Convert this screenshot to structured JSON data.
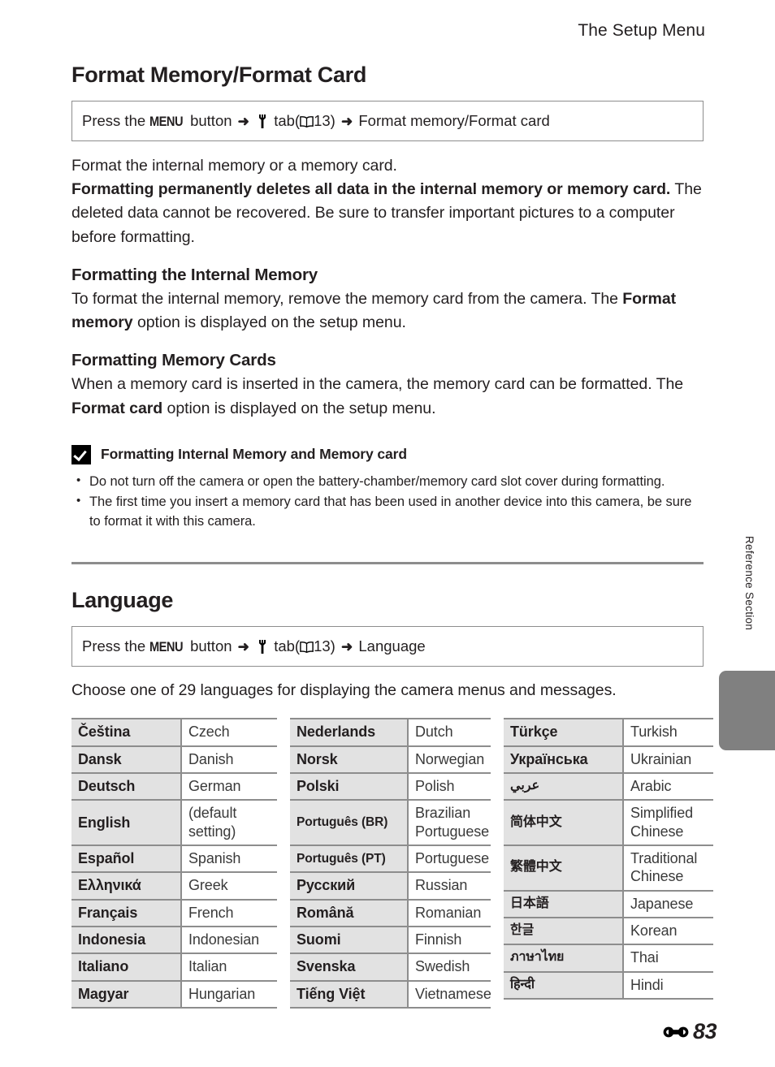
{
  "header": {
    "running_head": "The Setup Menu"
  },
  "format_section": {
    "title": "Format Memory/Format Card",
    "path": {
      "prefix": "Press the",
      "menu_label": "MENU",
      "button_word": "button",
      "arrow": "➜",
      "wrench_icon": "wrench-icon",
      "tab_word": "tab",
      "open_paren": "(",
      "book_icon": "book-icon",
      "page_ref": "13)",
      "arrow2": "➜",
      "destination": "Format memory/Format card"
    },
    "intro": "Format the internal memory or a memory card.",
    "warning_bold": "Formatting permanently deletes all data in the internal memory or memory card.",
    "warning_rest": "The deleted data cannot be recovered. Be sure to transfer important pictures to a computer before formatting.",
    "sub1": {
      "title": "Formatting the Internal Memory",
      "text_before": "To format the internal memory, remove the memory card from the camera. The",
      "bold_term": "Format memory",
      "text_after": "option is displayed on the setup menu."
    },
    "sub2": {
      "title": "Formatting Memory Cards",
      "line1": "When a memory card is inserted in the camera, the memory card can be formatted.",
      "text_before": "The",
      "bold_term": "Format card",
      "text_after": "option is displayed on the setup menu."
    },
    "caution": {
      "icon": "check-box-icon",
      "title": "Formatting Internal Memory and Memory card",
      "items": [
        "Do not turn off the camera or open the battery-chamber/memory card slot cover during formatting.",
        "The first time you insert a memory card that has been used in another device into this camera, be sure to format it with this camera."
      ]
    }
  },
  "language_section": {
    "title": "Language",
    "path": {
      "prefix": "Press the",
      "menu_label": "MENU",
      "button_word": "button",
      "arrow": "➜",
      "wrench_icon": "wrench-icon",
      "tab_word": "tab",
      "open_paren": "(",
      "book_icon": "book-icon",
      "page_ref": "13)",
      "arrow2": "➜",
      "destination": "Language"
    },
    "intro": "Choose one of 29 languages for displaying the camera menus and messages.",
    "columns": [
      {
        "rows": [
          {
            "native": "Čeština",
            "english": "Czech"
          },
          {
            "native": "Dansk",
            "english": "Danish"
          },
          {
            "native": "Deutsch",
            "english": "German"
          },
          {
            "native": "English",
            "english": "(default setting)"
          },
          {
            "native": "Español",
            "english": "Spanish"
          },
          {
            "native": "Ελληνικά",
            "english": "Greek"
          },
          {
            "native": "Français",
            "english": "French"
          },
          {
            "native": "Indonesia",
            "english": "Indonesian"
          },
          {
            "native": "Italiano",
            "english": "Italian"
          },
          {
            "native": "Magyar",
            "english": "Hungarian"
          }
        ]
      },
      {
        "rows": [
          {
            "native": "Nederlands",
            "english": "Dutch"
          },
          {
            "native": "Norsk",
            "english": "Norwegian"
          },
          {
            "native": "Polski",
            "english": "Polish"
          },
          {
            "native": "Português (BR)",
            "english": "Brazilian Portuguese"
          },
          {
            "native": "Português (PT)",
            "english": "Portuguese"
          },
          {
            "native": "Русский",
            "english": "Russian"
          },
          {
            "native": "Română",
            "english": "Romanian"
          },
          {
            "native": "Suomi",
            "english": "Finnish"
          },
          {
            "native": "Svenska",
            "english": "Swedish"
          },
          {
            "native": "Tiếng Việt",
            "english": "Vietnamese"
          }
        ]
      },
      {
        "rows": [
          {
            "native": "Türkçe",
            "english": "Turkish"
          },
          {
            "native": "Українська",
            "english": "Ukrainian"
          },
          {
            "native": "عربي",
            "english": "Arabic"
          },
          {
            "native": "简体中文",
            "english": "Simplified Chinese"
          },
          {
            "native": "繁體中文",
            "english": "Traditional Chinese"
          },
          {
            "native": "日本語",
            "english": "Japanese"
          },
          {
            "native": "한글",
            "english": "Korean"
          },
          {
            "native": "ภาษาไทย",
            "english": "Thai"
          },
          {
            "native": "हिन्दी",
            "english": "Hindi"
          }
        ]
      }
    ]
  },
  "side_tab": {
    "label": "Reference Section"
  },
  "footer": {
    "marker_icon": "e-section-marker-icon",
    "page_number": "83"
  },
  "colors": {
    "text": "#231f20",
    "rule": "#8d8d8d",
    "cell_shade": "#e2e2e2",
    "tab_gray": "#808080"
  }
}
